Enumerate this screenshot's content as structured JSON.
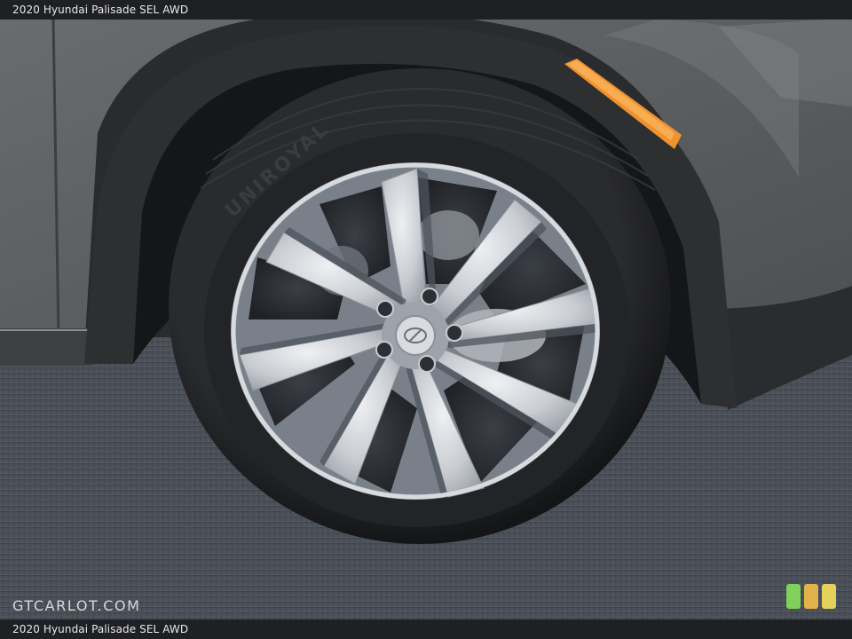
{
  "caption": {
    "top": "2020 Hyundai Palisade SEL AWD",
    "bottom": "2020 Hyundai Palisade SEL AWD"
  },
  "tire": {
    "sidewall_text": "UNIROYAL"
  },
  "watermark": {
    "text": "GTCARLOT.COM"
  },
  "palette": {
    "body_paint": "#5c5e60",
    "fender_trim": "#2e2f31",
    "asphalt": "#4a4f58",
    "tire": "#202124",
    "rim_silver": "#c9ccd1",
    "rim_dark": "#5a6069",
    "marker_amber": "#f0922e",
    "badge_colors": [
      "#7fd15b",
      "#e2b24a",
      "#e5d25a"
    ]
  }
}
